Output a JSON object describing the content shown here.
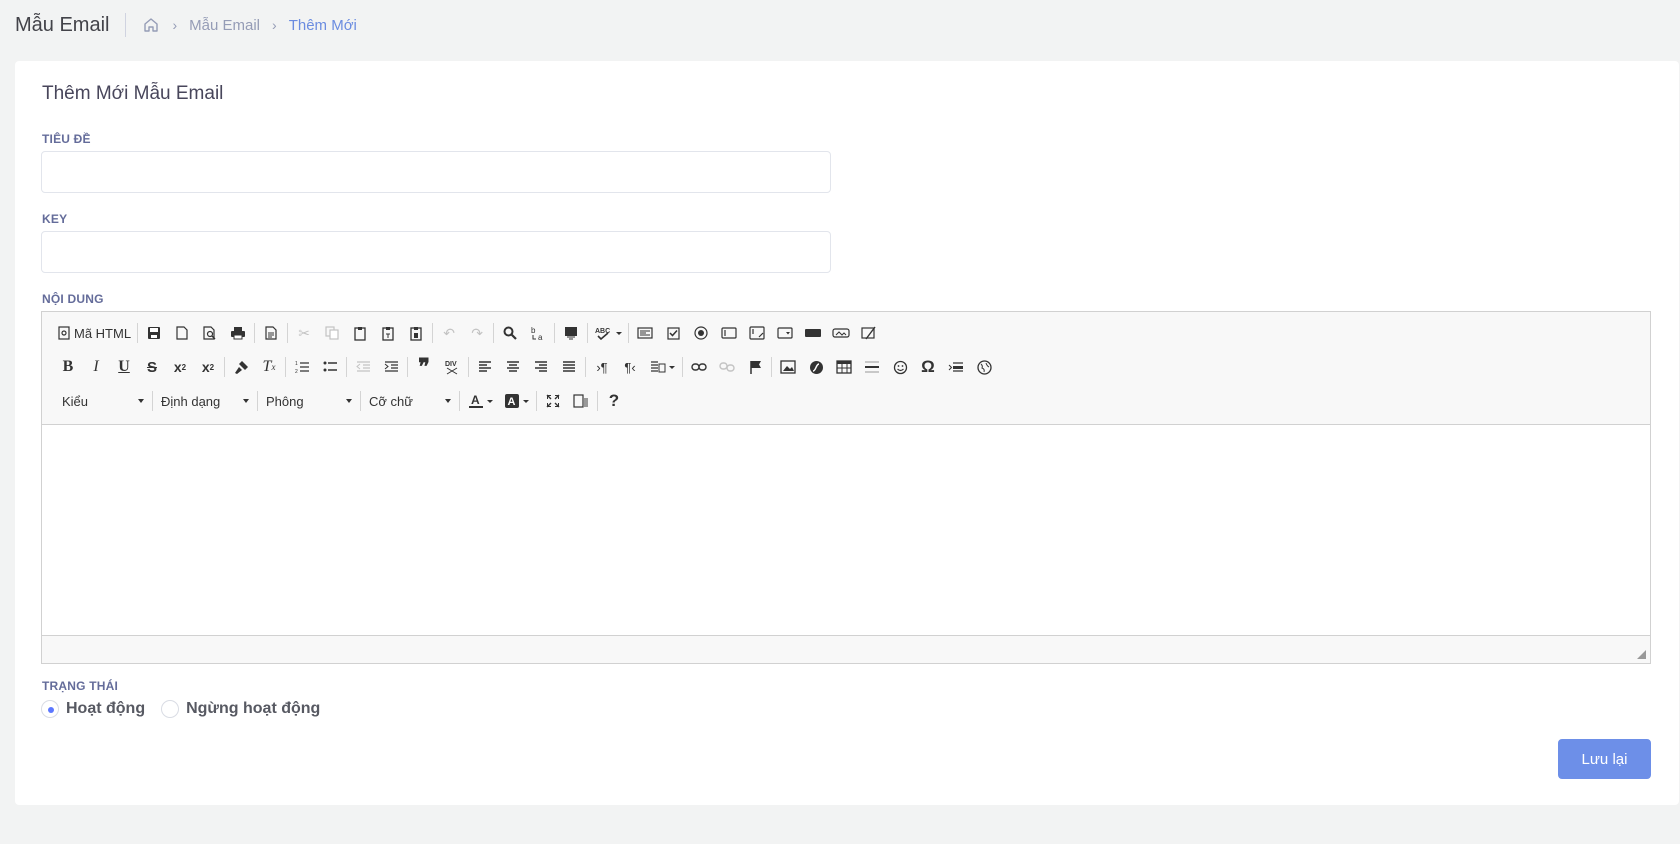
{
  "header": {
    "title": "Mẫu Email",
    "breadcrumb": {
      "items": [
        "Mẫu Email",
        "Thêm Mới"
      ]
    }
  },
  "form": {
    "title": "Thêm Mới Mẫu Email",
    "subject_label": "TIÊU ĐỀ",
    "subject_value": "",
    "key_label": "KEY",
    "key_value": "",
    "content_label": "NỘI DUNG",
    "status_label": "TRẠNG THÁI",
    "status_options": [
      "Hoạt động",
      "Ngừng hoạt động"
    ],
    "status_selected": "Hoạt động",
    "save_label": "Lưu lại"
  },
  "editor": {
    "source_label": "Mã HTML",
    "combos": [
      "Kiểu",
      "Định dạng",
      "Phông",
      "Cỡ chữ"
    ]
  },
  "colors": {
    "accent": "#6d8fe8",
    "breadcrumb_active": "#6b8ce0"
  }
}
